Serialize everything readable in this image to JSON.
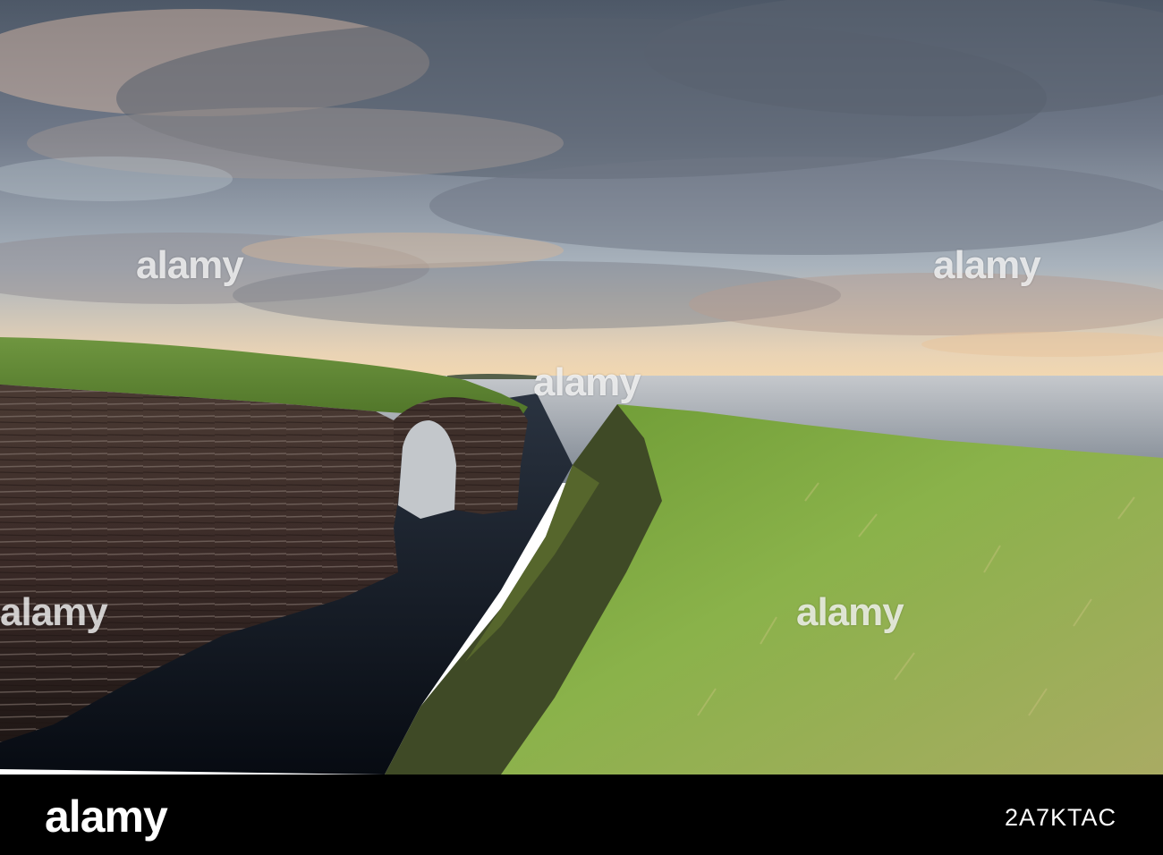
{
  "photo": {
    "scene": "coastal sea arch with grassy cliffs under a cloudy sky",
    "colors": {
      "sky_top": "#5f6b7a",
      "sky_glow": "#f2cfa8",
      "sea": "#9ba3ad",
      "water_dark": "#0f141c",
      "cliff_rock": "#3a2a26",
      "grass": "#7ea842",
      "grass_dry": "#b7b272"
    }
  },
  "watermark": {
    "text": "alamy"
  },
  "footer": {
    "logo": "alamy",
    "image_id": "2A7KTAC",
    "background": "#000000"
  }
}
